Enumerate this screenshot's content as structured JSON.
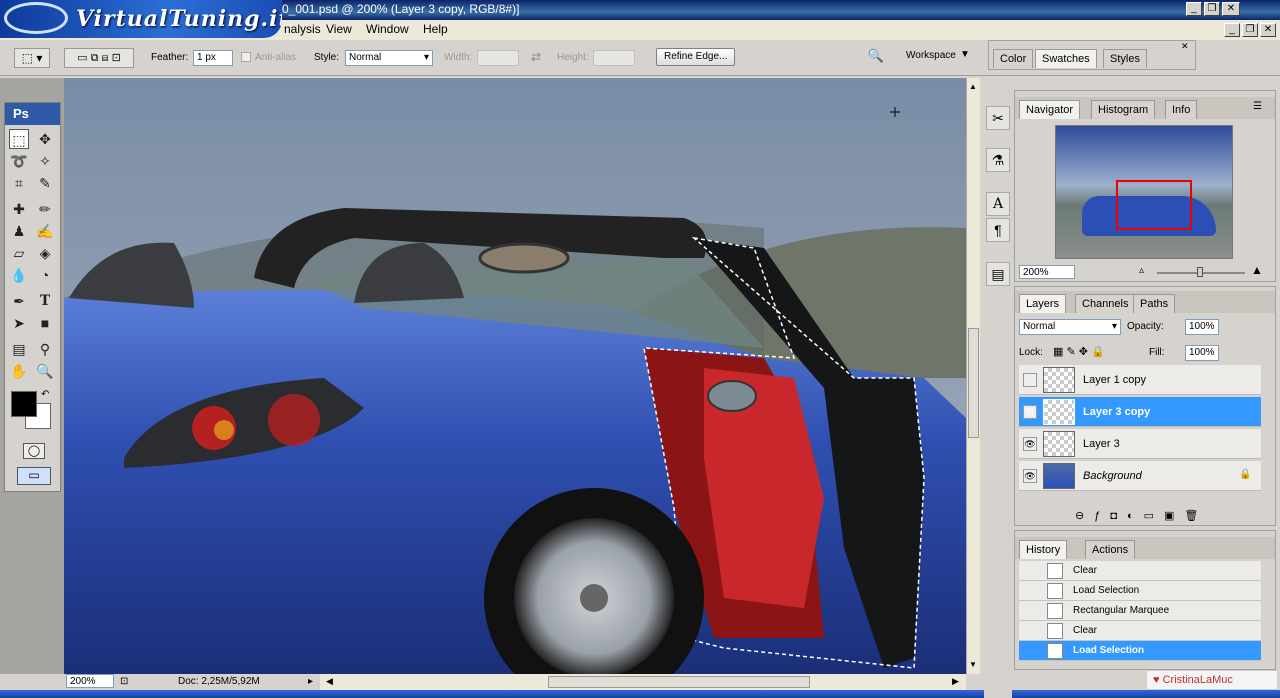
{
  "window": {
    "title": "0_001.psd @ 200% (Layer 3 copy, RGB/8#)]",
    "logo_text": "VirtualTuning.it"
  },
  "menu": [
    "nalysis",
    "View",
    "Window",
    "Help"
  ],
  "options": {
    "feather_label": "Feather:",
    "feather_value": "1 px",
    "antialias_label": "Anti-alias",
    "style_label": "Style:",
    "style_value": "Normal",
    "width_label": "Width:",
    "height_label": "Height:",
    "refine_edge": "Refine Edge...",
    "workspace": "Workspace"
  },
  "toolbox": {
    "logo": "Ps"
  },
  "status": {
    "zoom": "200%",
    "doc": "Doc: 2,25M/5,92M"
  },
  "color_panel": {
    "tabs": [
      "Color",
      "Swatches",
      "Styles"
    ]
  },
  "navigator": {
    "tabs": [
      "Navigator",
      "Histogram",
      "Info"
    ],
    "zoom": "200%"
  },
  "layers": {
    "tabs": [
      "Layers",
      "Channels",
      "Paths"
    ],
    "blend_mode": "Normal",
    "opacity_label": "Opacity:",
    "opacity": "100%",
    "lock_label": "Lock:",
    "fill_label": "Fill:",
    "fill": "100%",
    "items": [
      {
        "name": "Layer 1 copy",
        "visible": false,
        "selected": false
      },
      {
        "name": "Layer 3 copy",
        "visible": true,
        "selected": true
      },
      {
        "name": "Layer 3",
        "visible": true,
        "selected": false
      },
      {
        "name": "Background",
        "visible": true,
        "selected": false
      }
    ]
  },
  "history": {
    "tabs": [
      "History",
      "Actions"
    ],
    "items": [
      "Clear",
      "Load Selection",
      "Rectangular Marquee",
      "Clear",
      "Load Selection"
    ],
    "selected_index": 4
  },
  "watermark": "CristinaLaMuc"
}
